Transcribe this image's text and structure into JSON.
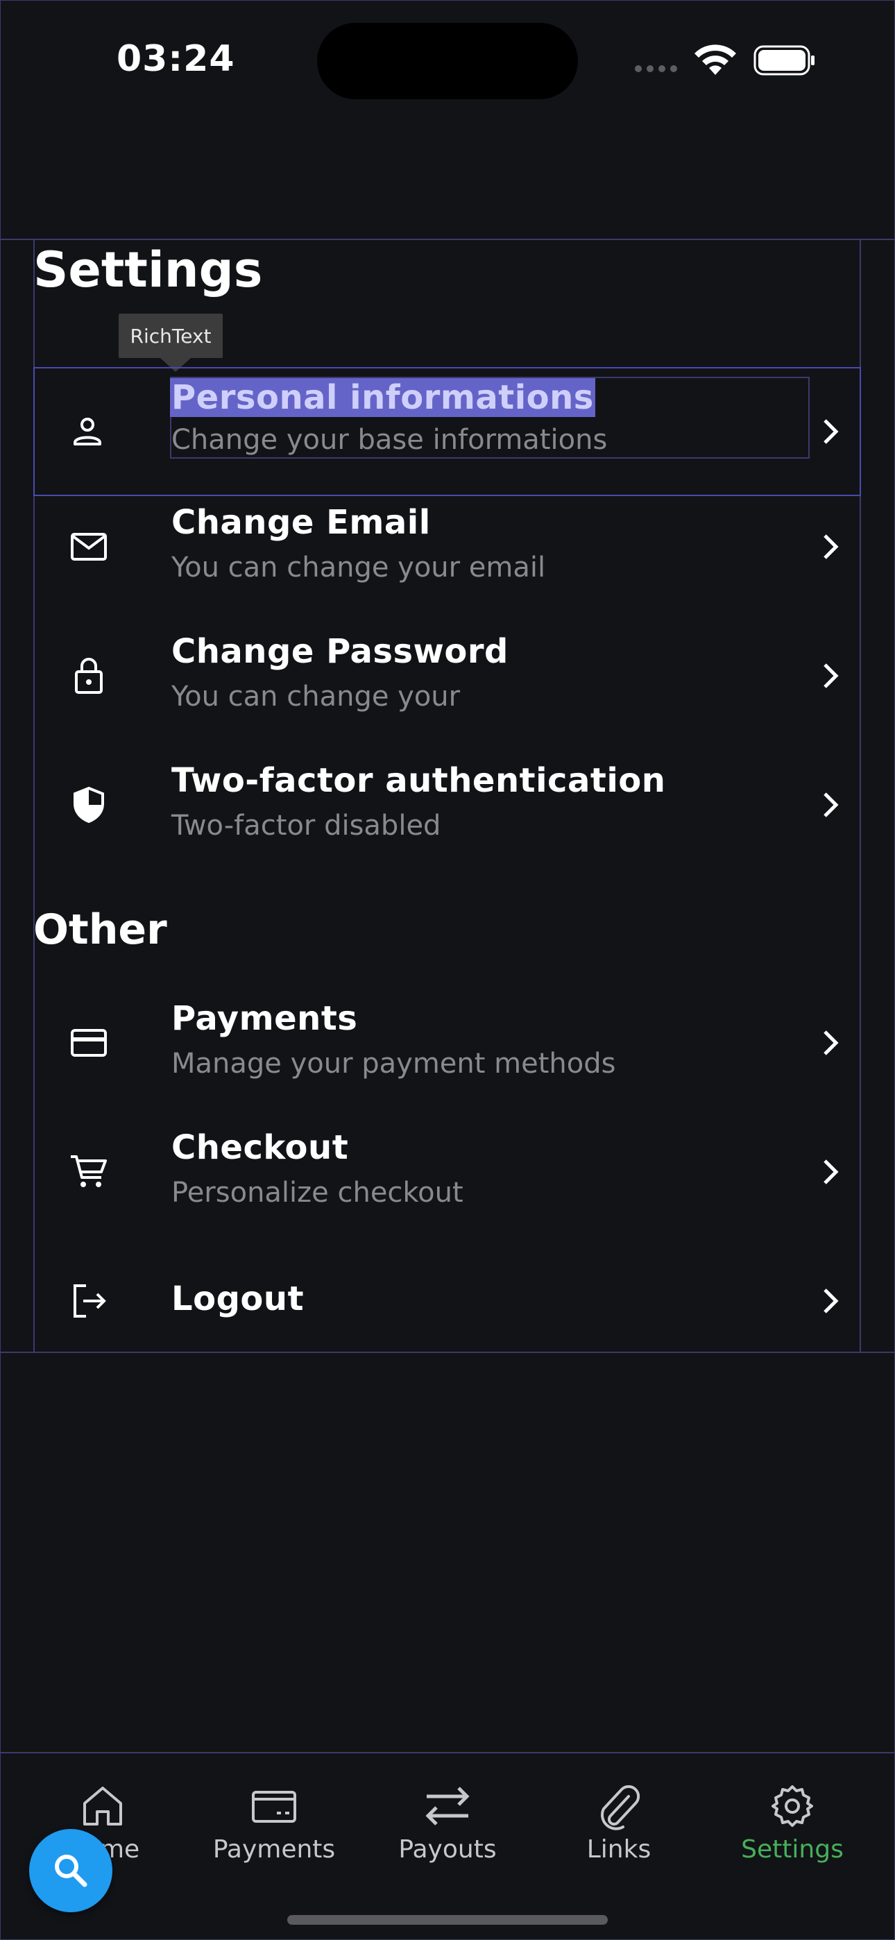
{
  "status_bar": {
    "time": "03:24"
  },
  "tooltip": {
    "text": "RichText"
  },
  "sections": {
    "settings_title": "Settings",
    "other_title": "Other"
  },
  "settings_items": [
    {
      "title": "Personal informations",
      "subtitle": "Change your base informations",
      "icon": "person-icon"
    },
    {
      "title": "Change Email",
      "subtitle": "You can change your email",
      "icon": "mail-icon"
    },
    {
      "title": "Change Password",
      "subtitle": "You can change your",
      "icon": "lock-icon"
    },
    {
      "title": "Two-factor authentication",
      "subtitle": "Two-factor disabled",
      "icon": "shield-icon"
    }
  ],
  "other_items": [
    {
      "title": "Payments",
      "subtitle": "Manage your payment methods",
      "icon": "credit-card-icon"
    },
    {
      "title": "Checkout",
      "subtitle": "Personalize checkout",
      "icon": "cart-icon"
    },
    {
      "title": "Logout",
      "subtitle": "",
      "icon": "logout-icon"
    }
  ],
  "bottom_nav": [
    {
      "label": "Home",
      "icon": "home-icon"
    },
    {
      "label": "Payments",
      "icon": "wallet-icon"
    },
    {
      "label": "Payouts",
      "icon": "swap-arrows-icon"
    },
    {
      "label": "Links",
      "icon": "paperclip-icon"
    },
    {
      "label": "Settings",
      "icon": "gear-icon",
      "active": true
    }
  ],
  "colors": {
    "background": "#121317",
    "active_nav": "#46b05a",
    "fab": "#1f9bf0",
    "subtitle": "#8a8a8e"
  }
}
